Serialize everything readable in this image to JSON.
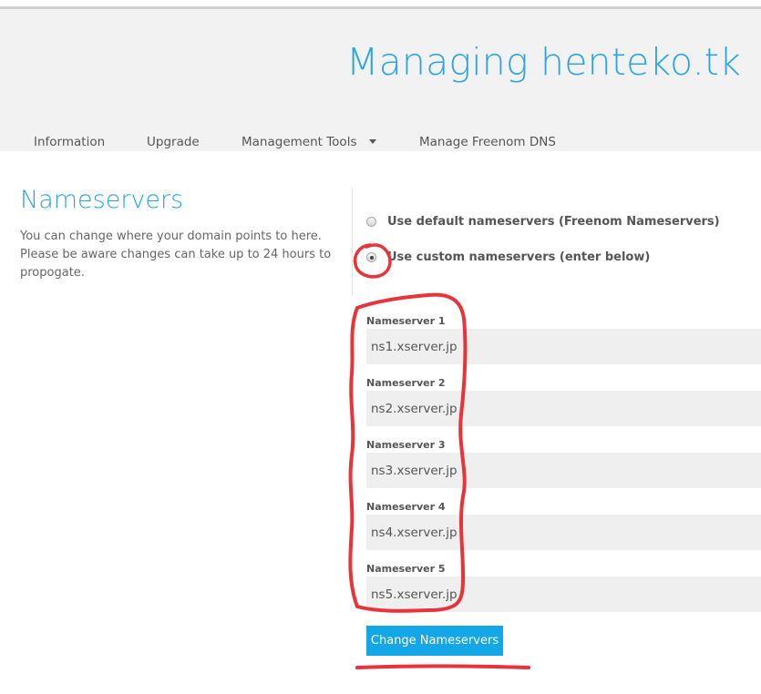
{
  "header": {
    "title": "Managing henteko.tk"
  },
  "nav": {
    "items": [
      {
        "label": "Information"
      },
      {
        "label": "Upgrade"
      },
      {
        "label": "Management Tools"
      },
      {
        "label": "Manage Freenom DNS"
      }
    ]
  },
  "section": {
    "title": "Nameservers",
    "description": "You can change where your domain points to here. Please be aware changes can take up to 24 hours to propogate."
  },
  "options": {
    "default_label": "Use default nameservers (Freenom Nameservers)",
    "custom_label": "Use custom nameservers (enter below)",
    "selected": "custom"
  },
  "nameservers": [
    {
      "label": "Nameserver 1",
      "value": "ns1.xserver.jp"
    },
    {
      "label": "Nameserver 2",
      "value": "ns2.xserver.jp"
    },
    {
      "label": "Nameserver 3",
      "value": "ns3.xserver.jp"
    },
    {
      "label": "Nameserver 4",
      "value": "ns4.xserver.jp"
    },
    {
      "label": "Nameserver 5",
      "value": "ns5.xserver.jp"
    }
  ],
  "submit_label": "Change Nameservers",
  "colors": {
    "accent": "#2aa5e0",
    "button": "#13a7e8",
    "annotation": "#e8333a"
  }
}
